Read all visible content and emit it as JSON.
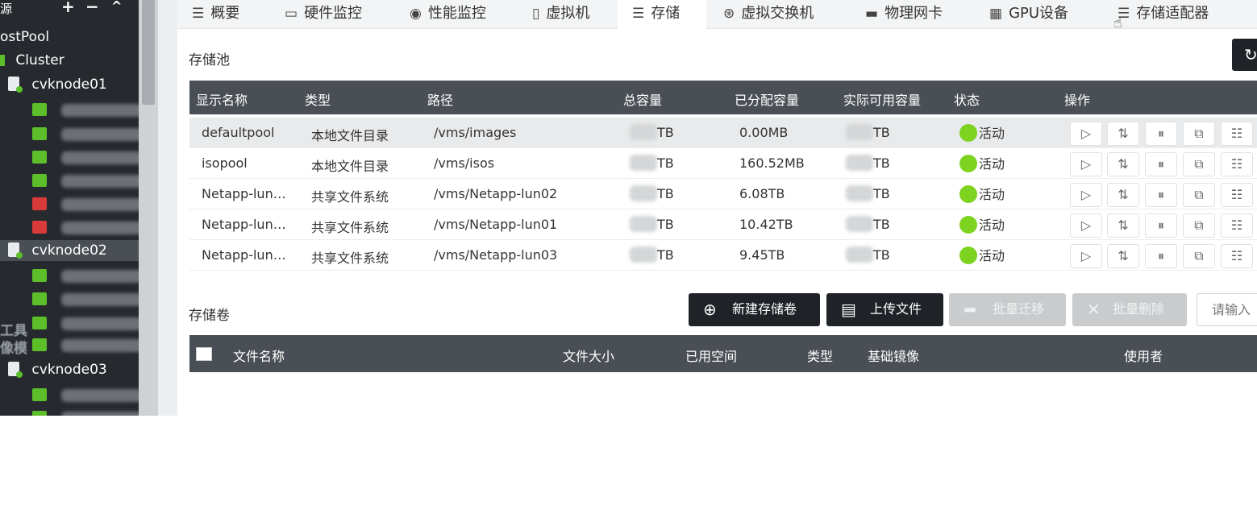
{
  "sidebar": {
    "header_label": "源",
    "add_label": "+",
    "remove_label": "−",
    "collapse_label": "^",
    "hostpool_label": "ostPool",
    "cluster_label": "Cluster",
    "nodes": [
      {
        "label": "cvknode01",
        "vm_colors": [
          "green",
          "green",
          "green",
          "green",
          "red",
          "red"
        ]
      },
      {
        "label": "cvknode02",
        "vm_colors": [
          "green",
          "green",
          "green",
          "green"
        ]
      },
      {
        "label": "cvknode03",
        "vm_colors": [
          "green",
          "green"
        ]
      }
    ],
    "tools_label": "工具",
    "images_label": "像模"
  },
  "tabs": [
    {
      "label": "概要",
      "icon": "list-icon"
    },
    {
      "label": "硬件监控",
      "icon": "monitor-icon"
    },
    {
      "label": "性能监控",
      "icon": "gauge-icon"
    },
    {
      "label": "虚拟机",
      "icon": "vm-icon"
    },
    {
      "label": "存储",
      "icon": "database-icon",
      "active": true
    },
    {
      "label": "虚拟交换机",
      "icon": "switch-icon"
    },
    {
      "label": "物理网卡",
      "icon": "nic-icon"
    },
    {
      "label": "GPU设备",
      "icon": "gpu-icon"
    },
    {
      "label": "存储适配器",
      "icon": "database-icon"
    }
  ],
  "pool_section": {
    "title": "存储池",
    "columns": [
      "显示名称",
      "类型",
      "路径",
      "总容量",
      "已分配容量",
      "实际可用容量",
      "状态",
      "操作"
    ],
    "rows": [
      {
        "name": "defaultpool",
        "type": "本地文件目录",
        "path": "/vms/images",
        "total": "TB",
        "allocated": "0.00MB",
        "available": "TB",
        "status": "活动"
      },
      {
        "name": "isopool",
        "type": "本地文件目录",
        "path": "/vms/isos",
        "total": "TB",
        "allocated": "160.52MB",
        "available": "TB",
        "status": "活动"
      },
      {
        "name": "Netapp-lun…",
        "type": "共享文件系统",
        "path": "/vms/Netapp-lun02",
        "total": "TB",
        "allocated": "6.08TB",
        "available": "TB",
        "status": "活动"
      },
      {
        "name": "Netapp-lun…",
        "type": "共享文件系统",
        "path": "/vms/Netapp-lun01",
        "total": "TB",
        "allocated": "10.42TB",
        "available": "TB",
        "status": "活动"
      },
      {
        "name": "Netapp-lun…",
        "type": "共享文件系统",
        "path": "/vms/Netapp-lun03",
        "total": "TB",
        "allocated": "9.45TB",
        "available": "TB",
        "status": "活动"
      }
    ],
    "row_actions": [
      "start-icon",
      "sync-icon",
      "pause-icon",
      "edit-icon",
      "details-icon"
    ]
  },
  "volume_section": {
    "title": "存储卷",
    "new_volume_label": "新建存储卷",
    "upload_label": "上传文件",
    "batch_migrate_label": "批量迁移",
    "batch_delete_label": "批量删除",
    "search_placeholder": "请输入",
    "columns": [
      "文件名称",
      "文件大小",
      "已用空间",
      "类型",
      "基础镜像",
      "使用者"
    ]
  },
  "colors": {
    "sidebar_bg": "#262a2f",
    "table_header_bg": "#4a4f55",
    "button_dark": "#1f2328",
    "status_active": "#7ed321",
    "node_online": "#5cbf2a",
    "vm_off": "#d93a3a"
  }
}
